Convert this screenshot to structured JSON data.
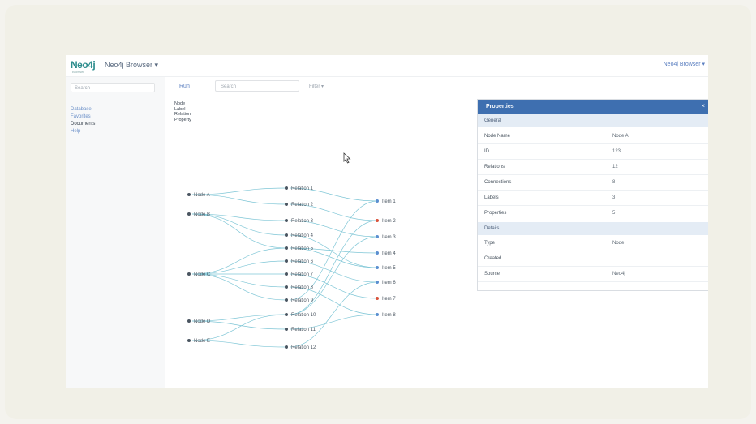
{
  "app": {
    "logo": "Neo4j",
    "logo_sub": "Browser",
    "title": "Neo4j Browser ▾",
    "user": "Neo4j Browser ▾"
  },
  "sidebar": {
    "search_placeholder": "Search",
    "items": [
      {
        "label": "Database",
        "active": false
      },
      {
        "label": "Favorites",
        "active": false
      },
      {
        "label": "Documents",
        "active": true
      },
      {
        "label": "Help",
        "active": false
      }
    ]
  },
  "toolbar": {
    "run_label": "Run",
    "search_placeholder": "Search",
    "filter_label": "Filter ▾"
  },
  "legend": [
    "Node",
    "Label",
    "Relation",
    "Property"
  ],
  "graph": {
    "left_nodes": [
      "Node A",
      "Node B",
      "Node C",
      "Node D",
      "Node E"
    ],
    "mid_nodes": [
      "Relation 1",
      "Relation 2",
      "Relation 3",
      "Relation 4",
      "Relation 5",
      "Relation 6",
      "Relation 7",
      "Relation 8",
      "Relation 9",
      "Relation 10",
      "Relation 11",
      "Relation 12"
    ],
    "right_nodes": [
      "Item 1",
      "Item 2",
      "Item 3",
      "Item 4",
      "Item 5",
      "Item 6",
      "Item 7",
      "Item 8"
    ],
    "edge_color": "#7fc6d6",
    "node_color": "#5b8fd0",
    "alert_color": "#d9533c"
  },
  "properties": {
    "title": "Properties",
    "close": "×",
    "general_section": "General",
    "general_rows": [
      {
        "key": "Node Name",
        "value": "Node A"
      },
      {
        "key": "ID",
        "value": "123"
      },
      {
        "key": "Relations",
        "value": "12"
      },
      {
        "key": "Connections",
        "value": "8"
      },
      {
        "key": "Labels",
        "value": "3"
      },
      {
        "key": "Properties",
        "value": "5"
      }
    ],
    "details_section": "Details",
    "detail_rows": [
      {
        "key": "Type",
        "value": "Node"
      },
      {
        "key": "Created",
        "value": ""
      },
      {
        "key": "Source",
        "value": "Neo4j"
      }
    ]
  }
}
